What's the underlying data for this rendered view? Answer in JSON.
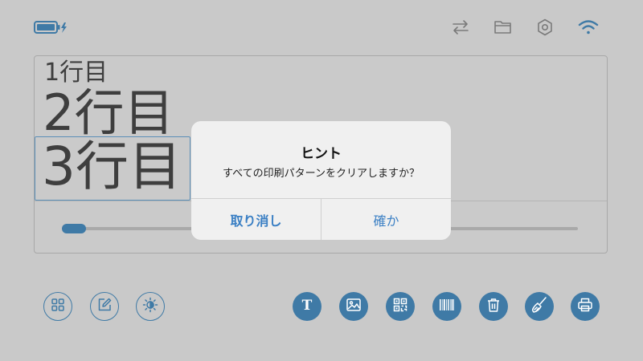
{
  "text_lines": {
    "line1": "1行目",
    "line2": "2行目",
    "line3": "3行目"
  },
  "dialog": {
    "title": "ヒント",
    "message": "すべての印刷パターンをクリアしますか？",
    "cancel_label": "取り消し",
    "confirm_label": "確か"
  },
  "icons": {
    "status_bar": [
      "battery-charging-icon",
      "swap-arrows-icon",
      "folder-icon",
      "settings-icon",
      "wifi-icon"
    ],
    "toolbar_left": [
      "grid-icon",
      "edit-icon",
      "brightness-icon"
    ],
    "toolbar_right": [
      "text-icon",
      "image-icon",
      "qr-code-icon",
      "barcode-icon",
      "trash-icon",
      "broom-icon",
      "print-icon"
    ]
  },
  "colors": {
    "accent": "#3f7aa6",
    "dialog_button": "#3a7fc4",
    "background": "#c9c9c9"
  }
}
